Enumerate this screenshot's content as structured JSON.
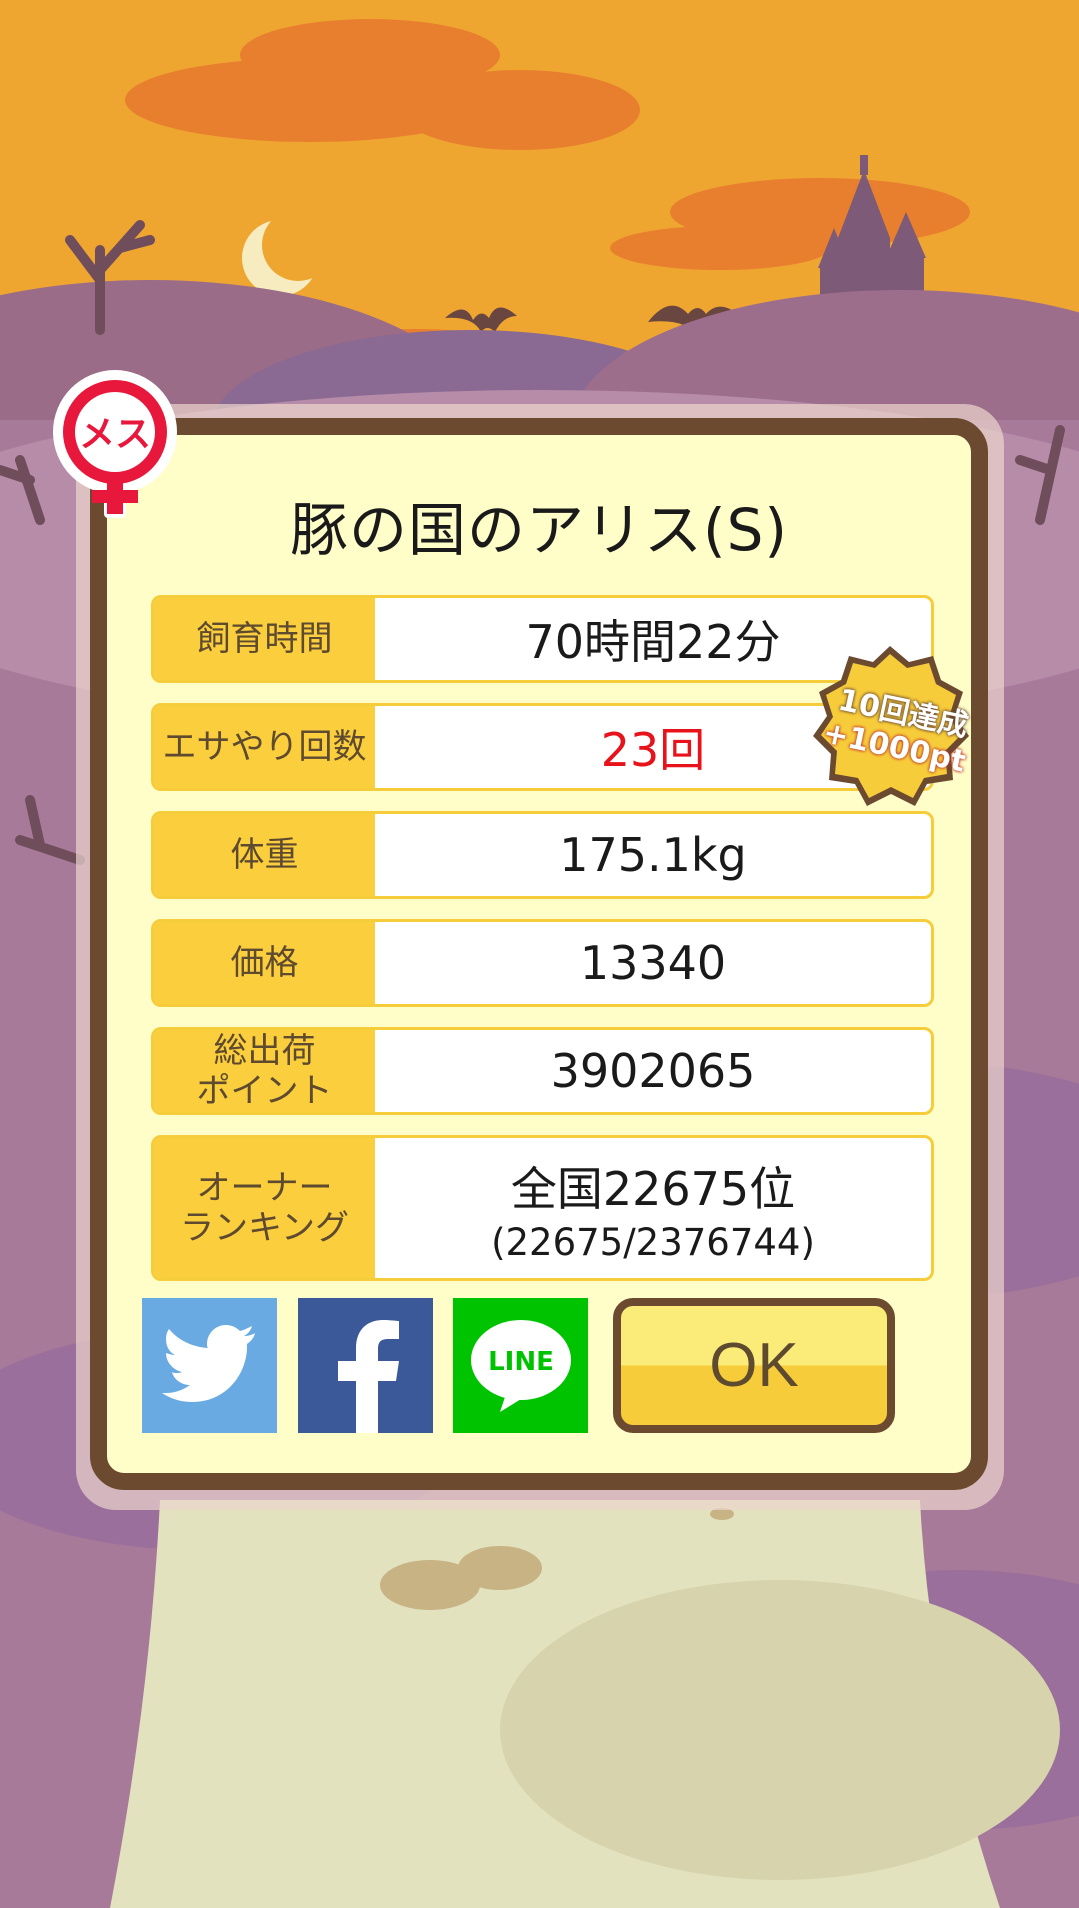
{
  "title": "豚の国のアリス(S)",
  "gender_badge": {
    "label": "メス",
    "color": "#e8173c"
  },
  "rows": [
    {
      "label": "飼育時間",
      "value": "70時間22分"
    },
    {
      "label": "エサやり回数",
      "value": "23回",
      "value_color": "#e8121a"
    },
    {
      "label": "体重",
      "value": "175.1kg"
    },
    {
      "label": "価格",
      "value": "13340"
    },
    {
      "label": "総出荷\nポイント",
      "value": "3902065"
    },
    {
      "label": "オーナー\nランキング",
      "value": "全国22675位",
      "sub": "(22675/2376744)"
    }
  ],
  "achievement": {
    "line1": "10回達成",
    "line2": "+1000pt"
  },
  "share": [
    {
      "name": "twitter",
      "color": "#6aaae2",
      "icon": "bird-icon"
    },
    {
      "name": "facebook",
      "color": "#3b5998",
      "icon": "f-icon"
    },
    {
      "name": "line",
      "color": "#00c300",
      "label": "LINE"
    }
  ],
  "ok_label": "OK"
}
